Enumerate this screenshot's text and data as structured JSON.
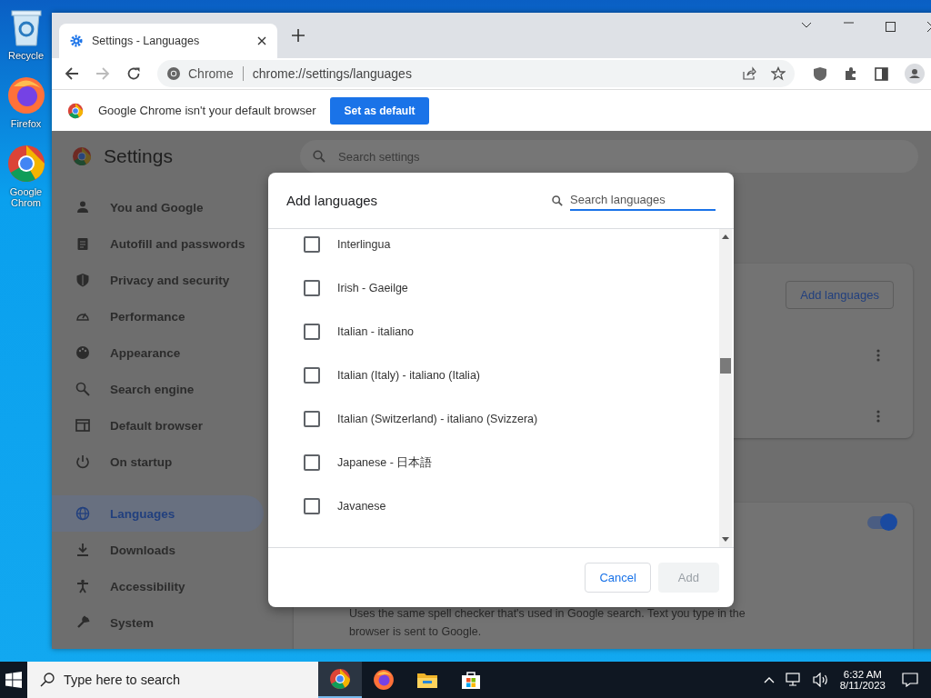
{
  "desktop": {
    "icons": [
      {
        "kind": "recycle",
        "label": "Recycle"
      },
      {
        "kind": "firefox",
        "label": "Firefox"
      },
      {
        "kind": "chrome",
        "label": "Google Chrom"
      }
    ]
  },
  "browser": {
    "tabs": [
      {
        "title": "Settings - Languages",
        "selected": true
      }
    ],
    "nav": {
      "back_disabled": false,
      "forward_disabled": true
    },
    "omnibox": {
      "site": "Chrome",
      "url": "chrome://settings/languages"
    },
    "infobar": {
      "message": "Google Chrome isn't your default browser",
      "button": "Set as default"
    }
  },
  "settings": {
    "title": "Settings",
    "search": {
      "placeholder": "Search settings"
    },
    "sidebar": {
      "items": [
        {
          "label": "You and Google",
          "selected": false
        },
        {
          "label": "Autofill and passwords",
          "selected": false
        },
        {
          "label": "Privacy and security",
          "selected": false
        },
        {
          "label": "Performance",
          "selected": false
        },
        {
          "label": "Appearance",
          "selected": false
        },
        {
          "label": "Search engine",
          "selected": false
        },
        {
          "label": "Default browser",
          "selected": false
        },
        {
          "label": "On startup",
          "selected": false
        },
        {
          "label": "Languages",
          "selected": true
        },
        {
          "label": "Downloads",
          "selected": false
        },
        {
          "label": "Accessibility",
          "selected": false
        },
        {
          "label": "System",
          "selected": false
        }
      ]
    },
    "add_languages_button": "Add languages",
    "spell_check": {
      "on": true,
      "description": "Uses the same spell checker that's used in Google search. Text you type in the browser is sent to Google."
    }
  },
  "dialog": {
    "title": "Add languages",
    "search": {
      "placeholder": "Search languages"
    },
    "languages": [
      {
        "name": "Interlingua",
        "checked": false
      },
      {
        "name": "Irish - Gaeilge",
        "checked": false
      },
      {
        "name": "Italian - italiano",
        "checked": false
      },
      {
        "name": "Italian (Italy) - italiano (Italia)",
        "checked": false
      },
      {
        "name": "Italian (Switzerland) - italiano (Svizzera)",
        "checked": false
      },
      {
        "name": "Japanese - 日本語",
        "checked": false
      },
      {
        "name": "Javanese",
        "checked": false
      }
    ],
    "buttons": [
      {
        "label": "Cancel",
        "disabled": false
      },
      {
        "label": "Add",
        "disabled": true
      }
    ]
  },
  "taskbar": {
    "search": {
      "placeholder": "Type here to search"
    },
    "apps": [
      {
        "kind": "chrome",
        "active": true
      },
      {
        "kind": "firefox",
        "active": false
      },
      {
        "kind": "explorer",
        "active": false
      },
      {
        "kind": "store",
        "active": false
      }
    ],
    "time": "6:32 AM",
    "date": "8/11/2023"
  }
}
